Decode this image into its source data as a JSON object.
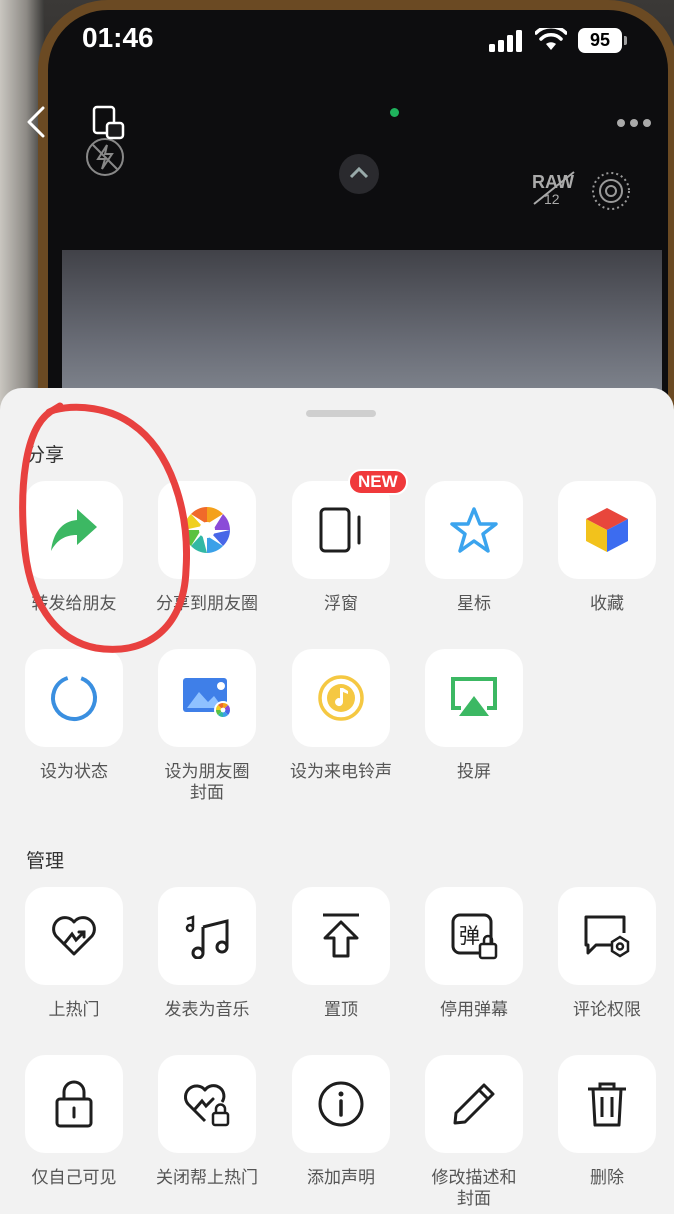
{
  "status_bar": {
    "time": "01:46",
    "battery": "95"
  },
  "sheet": {
    "share_section": {
      "title": "分享",
      "items": [
        {
          "label": "转发给朋友",
          "icon": "share-arrow-icon"
        },
        {
          "label": "分享到朋友圈",
          "icon": "moments-icon"
        },
        {
          "label": "浮窗",
          "icon": "float-window-icon",
          "badge": "NEW"
        },
        {
          "label": "星标",
          "icon": "star-icon"
        },
        {
          "label": "收藏",
          "icon": "favorites-cube-icon"
        },
        {
          "label": "设为状态",
          "icon": "status-ring-icon"
        },
        {
          "label": "设为朋友圈\n封面",
          "icon": "moments-cover-icon"
        },
        {
          "label": "设为来电铃声",
          "icon": "ringtone-icon"
        },
        {
          "label": "投屏",
          "icon": "airplay-icon"
        }
      ]
    },
    "manage_section": {
      "title": "管理",
      "items": [
        {
          "label": "上热门",
          "icon": "heart-promote-icon"
        },
        {
          "label": "发表为音乐",
          "icon": "music-note-icon"
        },
        {
          "label": "置顶",
          "icon": "pin-top-icon"
        },
        {
          "label": "停用弹幕",
          "icon": "danmaku-lock-icon"
        },
        {
          "label": "评论权限",
          "icon": "comment-settings-icon"
        },
        {
          "label": "仅自己可见",
          "icon": "lock-icon"
        },
        {
          "label": "关闭帮上热门",
          "icon": "heart-lock-icon"
        },
        {
          "label": "添加声明",
          "icon": "info-icon"
        },
        {
          "label": "修改描述和\n封面",
          "icon": "pencil-icon"
        },
        {
          "label": "删除",
          "icon": "trash-icon"
        }
      ]
    }
  },
  "colors": {
    "sheet_background": "#f2f2f2",
    "tile_background": "#ffffff",
    "accent_green": "#3cb863",
    "badge_red": "#f0393b",
    "annotation_red": "#e8413f"
  }
}
